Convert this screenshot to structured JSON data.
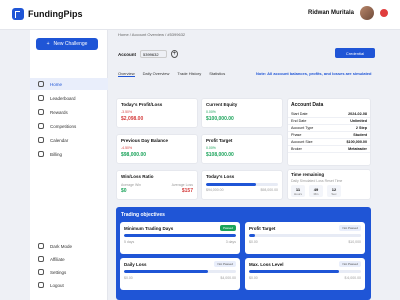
{
  "brand": {
    "name": "FundingPips",
    "color": "#1f55d6"
  },
  "user": {
    "name": "Ridwan Muritala"
  },
  "sidebar": {
    "new_challenge": "New Challenge",
    "items": [
      {
        "label": "Home",
        "icon": "home-icon",
        "active": true
      },
      {
        "label": "Leaderboard",
        "icon": "leaderboard-icon"
      },
      {
        "label": "Rewards",
        "icon": "rewards-icon"
      },
      {
        "label": "Competitions",
        "icon": "trophy-icon"
      },
      {
        "label": "Calendar",
        "icon": "calendar-icon"
      },
      {
        "label": "Billing",
        "icon": "billing-icon"
      }
    ],
    "bottom": [
      {
        "label": "Dark Mode",
        "icon": "moon-icon"
      },
      {
        "label": "Affiliate",
        "icon": "affiliate-icon"
      },
      {
        "label": "Settings",
        "icon": "gear-icon"
      },
      {
        "label": "Logout",
        "icon": "logout-icon"
      }
    ]
  },
  "breadcrumb": "Home / Account Overview / #5399632",
  "account": {
    "label": "Account",
    "value": "5399632"
  },
  "credential_button": "Credential",
  "tabs": [
    "Overview",
    "Daily Overview",
    "Trade History",
    "Statistics"
  ],
  "note": "Note: All account balances, profits, and losses are simulated",
  "cards": {
    "profit_loss": {
      "title": "Today's Profit/Loss",
      "pct": "-3.50%",
      "value": "$2,098.00"
    },
    "current_equity": {
      "title": "Current Equity",
      "pct": "0.00%",
      "value": "$100,000.00"
    },
    "prev_balance": {
      "title": "Previous Day Balance",
      "pct": "-4.50%",
      "value": "$98,000.00"
    },
    "profit_target": {
      "title": "Profit Target",
      "pct": "0.00%",
      "value": "$108,000.00"
    },
    "win_loss": {
      "title": "Win/Loss Ratio",
      "avg_win_label": "Average Win",
      "avg_loss_label": "Average Loss",
      "avg_win": "$0",
      "avg_loss": "$157"
    },
    "todays_loss": {
      "title": "Today's Loss",
      "left": "$94,000.00",
      "right": "$98,000.00"
    }
  },
  "account_data": {
    "title": "Account Data",
    "rows": [
      {
        "k": "Start Date",
        "v": "2024-02-08"
      },
      {
        "k": "End Date",
        "v": "Unlimited"
      },
      {
        "k": "Account Type",
        "v": "2 Step"
      },
      {
        "k": "Phase",
        "v": "Student"
      },
      {
        "k": "Account Size",
        "v": "$100,000.00"
      },
      {
        "k": "Broker",
        "v": "Metatrader"
      }
    ]
  },
  "time_remaining": {
    "title": "Time remaining",
    "subtitle": "Daily Simulated Loss Reset Time",
    "hours": "11",
    "mins": "49",
    "secs": "12",
    "hours_label": "Hours",
    "mins_label": "Min",
    "secs_label": "Sec"
  },
  "objectives": {
    "title": "Trading objectives",
    "items": [
      {
        "title": "Minimum Trading Days",
        "badge": "Passed",
        "badge_type": "green",
        "left": "5 days",
        "right": "3 days",
        "progress": 1.0
      },
      {
        "title": "Profit Target",
        "badge": "Not Passed",
        "badge_type": "gray",
        "left": "$0.00",
        "right": "$10,000",
        "progress": 0.05
      },
      {
        "title": "Daily Loss",
        "badge": "Not Passed",
        "badge_type": "gray",
        "left": "$0.00",
        "right": "$4,000.00",
        "progress": 0.75
      },
      {
        "title": "Max. Loss Level",
        "badge": "Not Passed",
        "badge_type": "gray",
        "left": "$0.00",
        "right": "$ 6,000.00",
        "progress": 0.8
      }
    ]
  }
}
